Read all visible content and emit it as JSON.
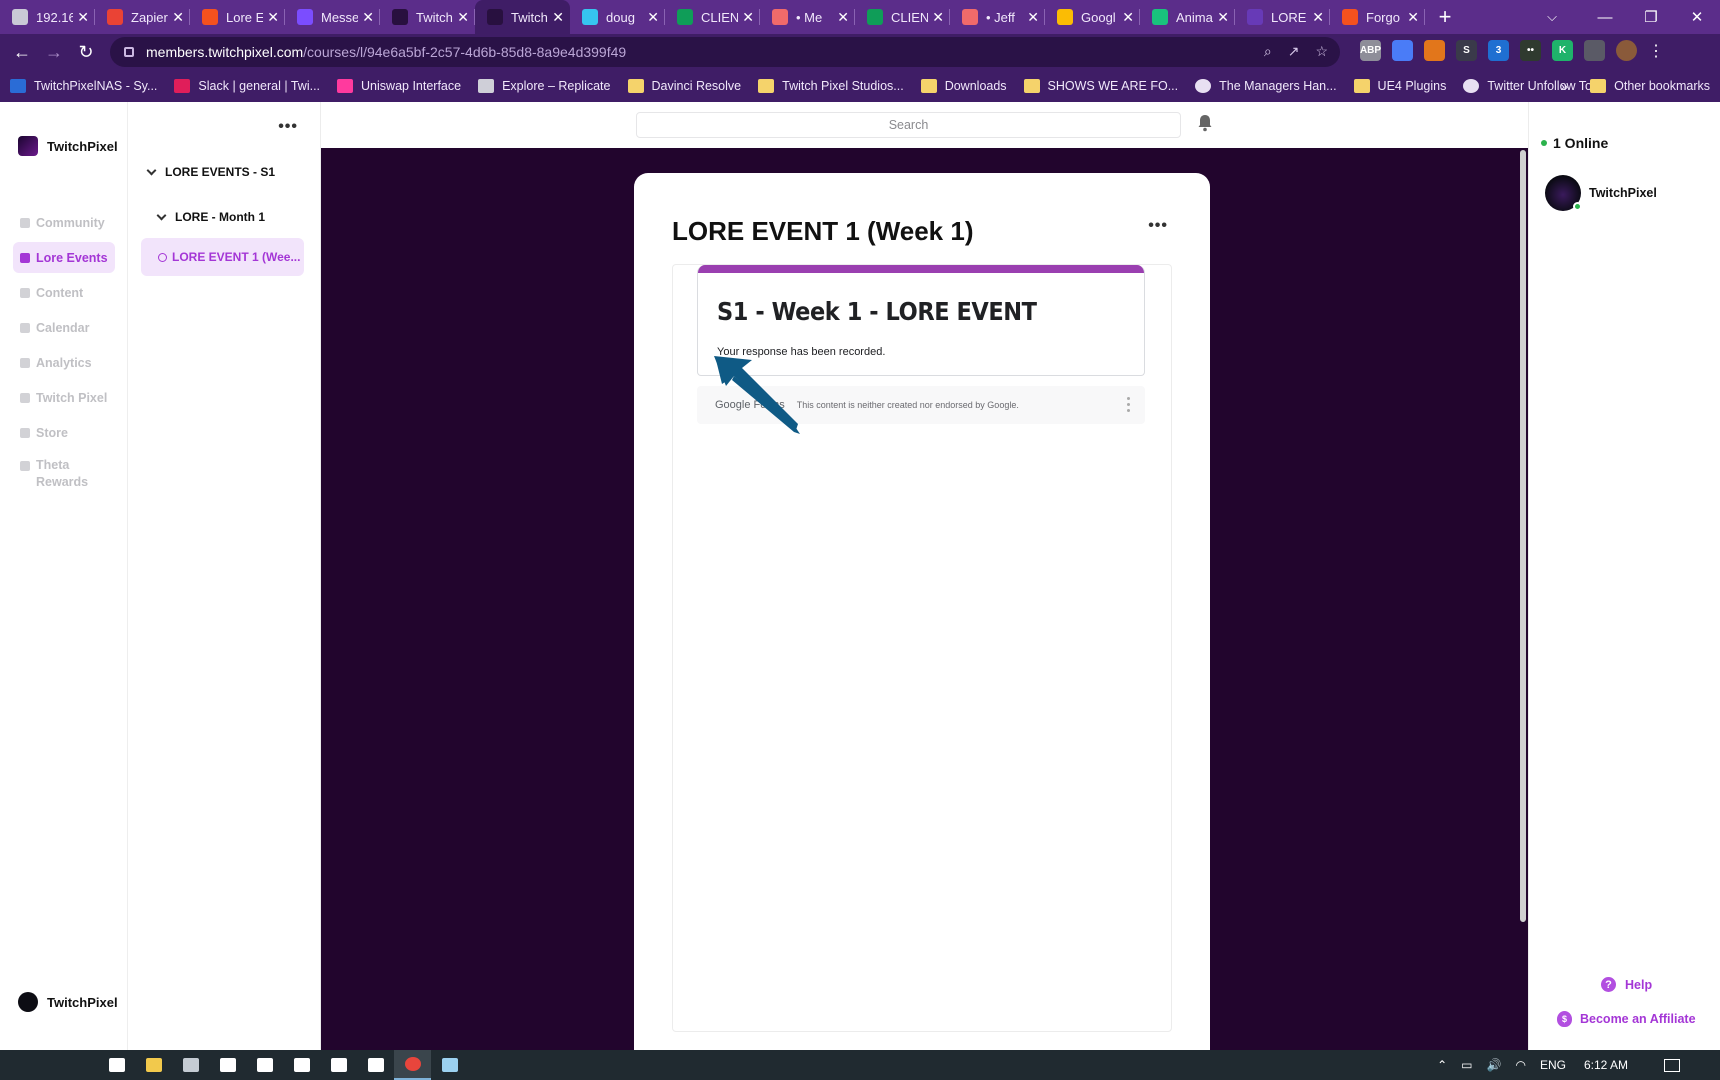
{
  "browser": {
    "tabs": [
      {
        "title": "192.16",
        "color": "#c9c9d6"
      },
      {
        "title": "Zapier",
        "color": "#ea4335"
      },
      {
        "title": "Lore E",
        "color": "#f4511e"
      },
      {
        "title": "Messe",
        "color": "#7b4dff"
      },
      {
        "title": "Twitch",
        "color": "#28103f"
      },
      {
        "title": "Twitch",
        "color": "#28103f",
        "active": true
      },
      {
        "title": "doug",
        "color": "#36c5f0"
      },
      {
        "title": "CLIEN",
        "color": "#0f9d58"
      },
      {
        "title": "• Me",
        "color": "#f06a6a"
      },
      {
        "title": "CLIEN",
        "color": "#0f9d58"
      },
      {
        "title": "• Jeff",
        "color": "#f06a6a"
      },
      {
        "title": "Googl",
        "color": "#fbbc04"
      },
      {
        "title": "Anima",
        "color": "#19c37d"
      },
      {
        "title": "LORE",
        "color": "#673ab7"
      },
      {
        "title": "Forgo",
        "color": "#f4511e"
      }
    ],
    "new_tab": "+",
    "url_host": "members.twitchpixel.com",
    "url_path": "/courses/l/94e6a5bf-2c57-4d6b-85d8-8a9e4d399f49",
    "bookmarks": [
      {
        "label": "TwitchPixelNAS - Sy...",
        "kind": "nas"
      },
      {
        "label": "Slack | general | Twi...",
        "kind": "slack"
      },
      {
        "label": "Uniswap Interface",
        "kind": "uni"
      },
      {
        "label": "Explore – Replicate",
        "kind": "rep"
      },
      {
        "label": "Davinci Resolve",
        "kind": "folder"
      },
      {
        "label": "Twitch Pixel Studios...",
        "kind": "folder"
      },
      {
        "label": "Downloads",
        "kind": "folder"
      },
      {
        "label": "SHOWS WE ARE FO...",
        "kind": "folder"
      },
      {
        "label": "The Managers Han...",
        "kind": "globe"
      },
      {
        "label": "UE4 Plugins",
        "kind": "folder"
      },
      {
        "label": "Twitter Unfollow To...",
        "kind": "globe"
      }
    ],
    "bookmarks_overflow": "»",
    "other_bookmarks": "Other bookmarks",
    "extensions": [
      {
        "label": "ABP",
        "color": "#8e8e99"
      },
      {
        "label": "",
        "color": "#4a7cf7"
      },
      {
        "label": "",
        "color": "#e2761b"
      },
      {
        "label": "S",
        "color": "#3a3a4a"
      },
      {
        "label": "3",
        "color": "#1f6fd1"
      },
      {
        "label": "••",
        "color": "#2f3a2f"
      },
      {
        "label": "K",
        "color": "#1fb36b"
      },
      {
        "label": "",
        "color": "#5a5a66"
      }
    ]
  },
  "app": {
    "brand": "TwitchPixel",
    "nav": [
      {
        "label": "Community",
        "icon": "community-icon"
      },
      {
        "label": "Lore Events",
        "icon": "book-icon",
        "active": true
      },
      {
        "label": "Content",
        "icon": "document-icon"
      },
      {
        "label": "Calendar",
        "icon": "calendar-icon"
      },
      {
        "label": "Analytics",
        "icon": "chart-icon"
      },
      {
        "label": "Twitch Pixel",
        "icon": "link-icon"
      },
      {
        "label": "Store",
        "icon": "link-icon"
      },
      {
        "label": "Theta Rewards",
        "icon": "link-icon"
      }
    ],
    "user_name": "TwitchPixel",
    "course_section": "LORE EVENTS - S1",
    "course_subsection": "LORE - Month 1",
    "course_lesson": "LORE EVENT 1 (Wee...",
    "search_placeholder": "Search",
    "lesson_title": "LORE EVENT 1 (Week 1)",
    "form": {
      "title": "S1 - Week 1 - LORE EVENT",
      "message": "Your response has been recorded.",
      "footer_brand": "Google Forms",
      "disclaimer": "This content is neither created nor endorsed by Google."
    },
    "online_count": "1 Online",
    "online_member": "TwitchPixel",
    "help": "Help",
    "affiliate": "Become an Affiliate"
  },
  "taskbar": {
    "apps": [
      {
        "name": "task-view",
        "color": "#ffffff"
      },
      {
        "name": "file-explorer",
        "color": "#f2c94c"
      },
      {
        "name": "calculator",
        "color": "#c5ccd3"
      },
      {
        "name": "apps",
        "color": "#ffffff"
      },
      {
        "name": "settings",
        "color": "#ffffff"
      },
      {
        "name": "network",
        "color": "#ffffff"
      },
      {
        "name": "stocks",
        "color": "#ffffff"
      },
      {
        "name": "games",
        "color": "#ffffff"
      },
      {
        "name": "chrome",
        "color": "#e8453c",
        "active": true
      },
      {
        "name": "notepad",
        "color": "#9cd1f0"
      }
    ],
    "language": "ENG",
    "time": "6:12 AM"
  }
}
